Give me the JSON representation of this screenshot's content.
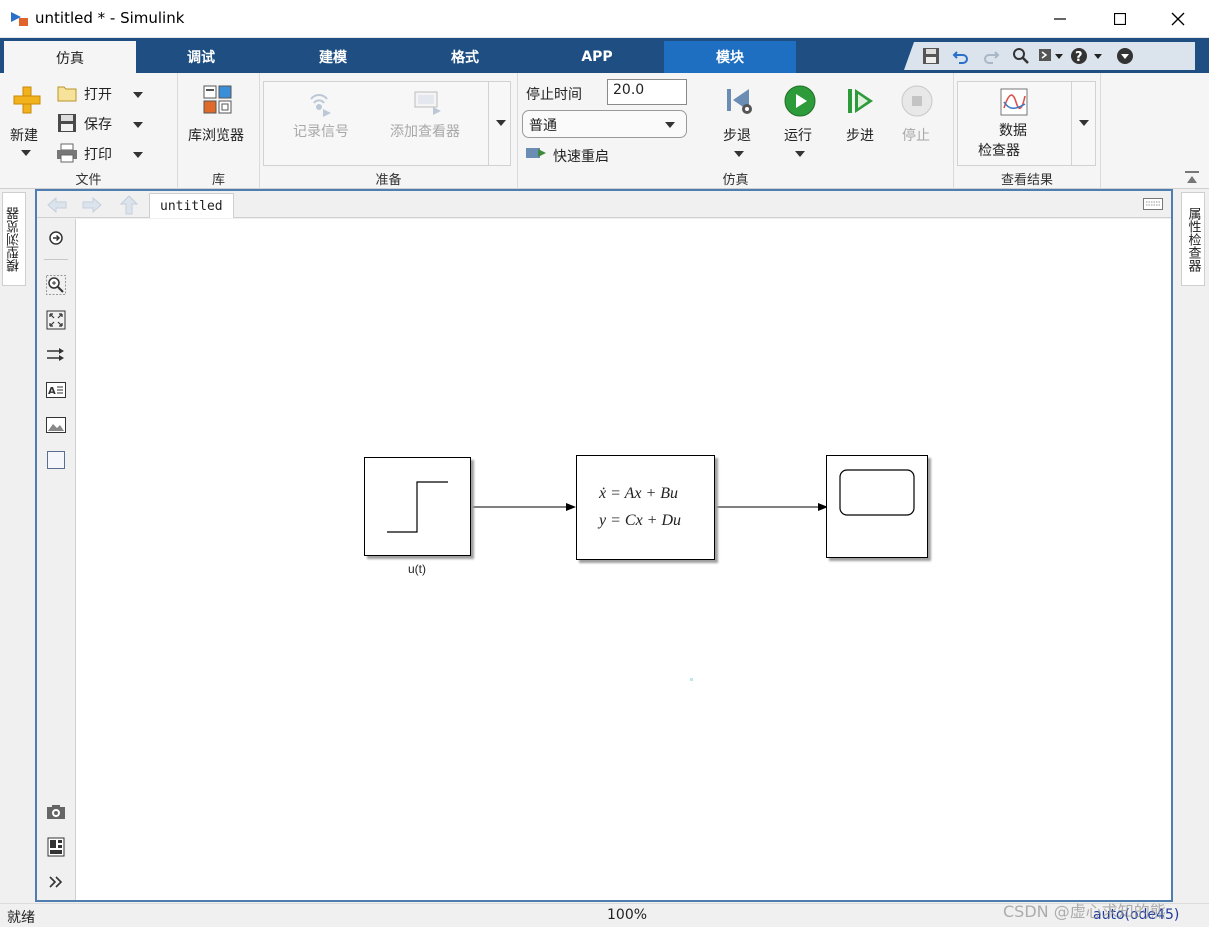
{
  "window": {
    "title": "untitled * - Simulink"
  },
  "tabs": [
    {
      "label": "仿真"
    },
    {
      "label": "调试"
    },
    {
      "label": "建模"
    },
    {
      "label": "格式"
    },
    {
      "label": "APP"
    },
    {
      "label": "模块"
    }
  ],
  "toolstrip": {
    "file": {
      "new_label": "新建",
      "open_label": "打开",
      "save_label": "保存",
      "print_label": "打印",
      "section": "文件"
    },
    "library": {
      "browser_label": "库浏览器",
      "section": "库"
    },
    "prepare": {
      "log_signals": "记录信号",
      "add_viewer": "添加查看器",
      "section": "准备"
    },
    "simulate": {
      "stop_time_label": "停止时间",
      "stop_time_value": "20.0",
      "mode_value": "普通",
      "fast_restart": "快速重启",
      "step_back": "步退",
      "run": "运行",
      "step_forward": "步进",
      "stop": "停止",
      "section": "仿真"
    },
    "review": {
      "data_inspector_line1": "数据",
      "data_inspector_line2": "检查器",
      "section": "查看结果"
    }
  },
  "side_panels": {
    "left": "模型浏览器",
    "right": "属性检查器"
  },
  "editor": {
    "doc_tab": "untitled"
  },
  "diagram": {
    "step_block_label": "u(t)",
    "state_space_eq1": "ẋ = Ax + Bu",
    "state_space_eq2": "y = Cx + Du"
  },
  "statusbar": {
    "status": "就绪",
    "zoom": "100%",
    "solver": "auto(ode45)"
  },
  "watermark": "CSDN @虚心求知的熊",
  "colors": {
    "tab_bar": "#1e4e82",
    "tab_highlight": "#1e6fc2",
    "editor_border": "#4f7db0",
    "run_green": "#2e9b3b",
    "solver_link": "#1b3a9c"
  }
}
